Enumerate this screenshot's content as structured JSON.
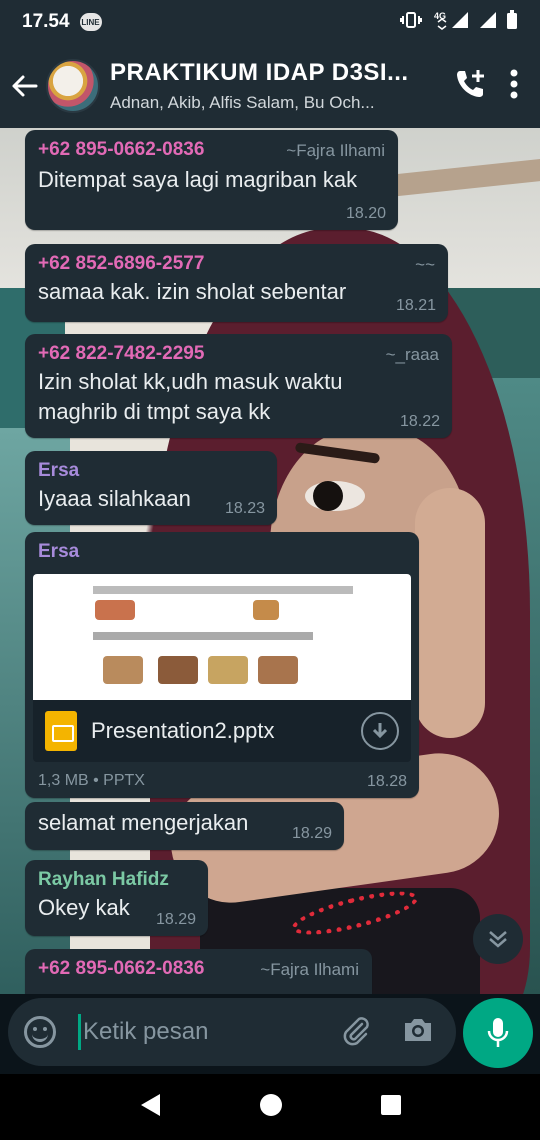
{
  "status_bar": {
    "time": "17.54",
    "line_badge": "LINE",
    "network": "4G"
  },
  "header": {
    "title": "PRAKTIKUM IDAP D3SI...",
    "subtitle": "Adnan, Akib, Alfis Salam, Bu Och..."
  },
  "messages": [
    {
      "sender": "+62 895-0662-0836",
      "alias": "~Fajra Ilhami",
      "text": "Ditempat saya lagi magriban kak",
      "time": "18.20",
      "color": "#e26ab6"
    },
    {
      "sender": "+62 852-6896-2577",
      "alias": "~~",
      "text": "samaa kak. izin sholat sebentar",
      "time": "18.21",
      "color": "#e26ab6"
    },
    {
      "sender": "+62 822-7482-2295",
      "alias": "~_raaa",
      "text_line1": "Izin sholat kk,udh masuk waktu",
      "text_line2": "maghrib di tmpt saya kk",
      "time": "18.22",
      "color": "#e26ab6"
    },
    {
      "sender": "Ersa",
      "text": "Iyaaa silahkaan",
      "time": "18.23",
      "color": "#a78bdb"
    },
    {
      "sender": "Ersa",
      "doc_name": "Presentation2.pptx",
      "doc_meta": "1,3 MB • PPTX",
      "time": "18.28",
      "color": "#a78bdb"
    },
    {
      "text": "selamat mengerjakan",
      "time": "18.29"
    },
    {
      "sender": "Rayhan Hafidz",
      "text": "Okey kak",
      "time": "18.29",
      "color": "#7bc9a4"
    },
    {
      "sender": "+62 895-0662-0836",
      "alias": "~Fajra Ilhami",
      "color": "#e26ab6"
    }
  ],
  "input": {
    "placeholder": "Ketik pesan"
  },
  "colors": {
    "accent": "#00a884",
    "bubble": "#1f2c34",
    "header": "#1f2c34"
  }
}
